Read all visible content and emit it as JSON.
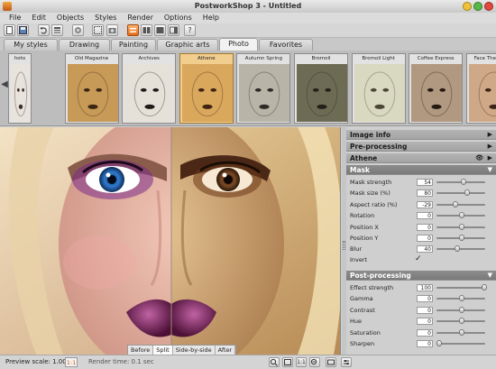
{
  "window": {
    "title": "PostworkShop 3 - Untitled"
  },
  "menu": [
    "File",
    "Edit",
    "Objects",
    "Styles",
    "Render",
    "Options",
    "Help"
  ],
  "toolbar": {
    "icons": [
      "new-icon",
      "save-icon",
      "undo-icon",
      "layers-icon",
      "select-icon",
      "screenshot-icon",
      "brush-icon",
      "view-single-icon",
      "view-split-icon",
      "view-sidebyside-icon",
      "layout-icon",
      "help-icon"
    ],
    "help_label": "?"
  },
  "tabs": [
    "My styles",
    "Drawing",
    "Painting",
    "Graphic arts",
    "Photo",
    "Favorites"
  ],
  "active_tab": "Photo",
  "styles": [
    {
      "label": "hoto",
      "tone": "#e8e3dc",
      "ink": "#3a2f2a"
    },
    {
      "label": "Old Magazine",
      "tone": "#c79a58",
      "ink": "#3b2612"
    },
    {
      "label": "Archives",
      "tone": "#e6e1d8",
      "ink": "#1e1b19"
    },
    {
      "label": "Athene",
      "tone": "#d9a85d",
      "ink": "#412312"
    },
    {
      "label": "Autumn Spring",
      "tone": "#b8b4a8",
      "ink": "#2d2a25"
    },
    {
      "label": "Bromoil",
      "tone": "#6e6b55",
      "ink": "#23211a"
    },
    {
      "label": "Bromoil Light",
      "tone": "#d9d8c1",
      "ink": "#4b4735"
    },
    {
      "label": "Coffee Express",
      "tone": "#b19880",
      "ink": "#241a12"
    },
    {
      "label": "Face The Mirror",
      "tone": "#cfa987",
      "ink": "#3b2418"
    }
  ],
  "active_style": "Athene",
  "compare_modes": [
    "Before",
    "Split",
    "Side-by-side",
    "After"
  ],
  "active_compare": "Split",
  "panel": {
    "sections_top": [
      {
        "title": "Image info",
        "arrow": "▶"
      },
      {
        "title": "Pre-processing",
        "arrow": "▶"
      },
      {
        "title": "Athene",
        "arrow": "▶",
        "eye": "👁"
      }
    ],
    "mask": {
      "title": "Mask",
      "arrow": "▼",
      "params": [
        {
          "label": "Mask strength",
          "value": "54",
          "pos": 0.54
        },
        {
          "label": "Mask size (%)",
          "value": "80",
          "pos": 0.62
        },
        {
          "label": "Aspect ratio (%)",
          "value": "-29",
          "pos": 0.36
        },
        {
          "label": "Rotation",
          "value": "0",
          "pos": 0.5
        },
        {
          "label": "Position X",
          "value": "0",
          "pos": 0.5
        },
        {
          "label": "Position Y",
          "value": "0",
          "pos": 0.5
        },
        {
          "label": "Blur",
          "value": "40",
          "pos": 0.4
        }
      ],
      "invert_label": "Invert",
      "invert_checked": "✓"
    },
    "post": {
      "title": "Post-processing",
      "arrow": "▼",
      "params": [
        {
          "label": "Effect strength",
          "value": "100",
          "pos": 1.0
        },
        {
          "label": "Gamma",
          "value": "0",
          "pos": 0.5
        },
        {
          "label": "Contrast",
          "value": "0",
          "pos": 0.5
        },
        {
          "label": "Hue",
          "value": "0",
          "pos": 0.5
        },
        {
          "label": "Saturation",
          "value": "0",
          "pos": 0.5
        },
        {
          "label": "Sharpen",
          "value": "0",
          "pos": 0.0
        }
      ]
    }
  },
  "status": {
    "preview_label": "Preview scale: 1.00",
    "scale_button": "1:1",
    "render_time": "Render time: 0.1 sec",
    "zoom_label": "1:1"
  },
  "colors": {
    "accent": "#e87a1a",
    "active_tab": "#f2f2f2",
    "panel_header": "#7f7f7f"
  }
}
